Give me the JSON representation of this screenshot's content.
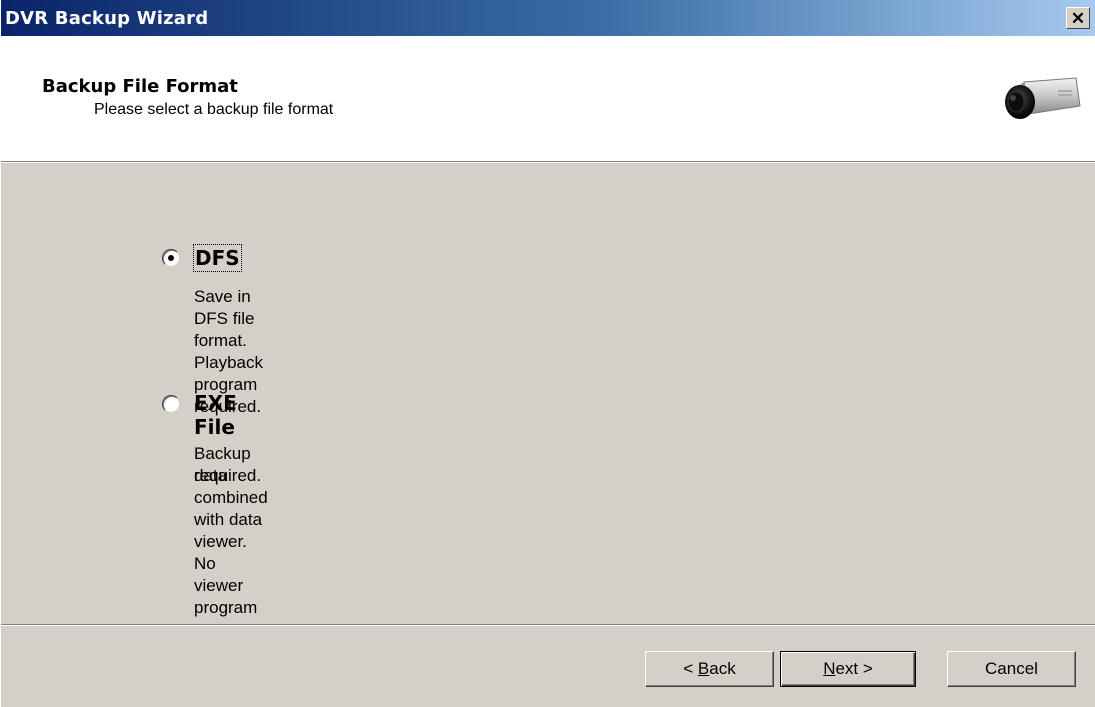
{
  "window": {
    "title": "DVR Backup Wizard",
    "close_glyph": "✕",
    "close_icon": "close-icon"
  },
  "header": {
    "title": "Backup File Format",
    "subtitle": "Please select a backup file format",
    "image_icon": "camera-icon"
  },
  "options": [
    {
      "label": "DFS",
      "description": "Save in DFS file format. Playback program required.",
      "selected": true
    },
    {
      "label": "EXE File",
      "description_line1": "Backup data combined with data viewer. No viewer program",
      "description_line2": "required.",
      "selected": false
    }
  ],
  "buttons": {
    "back_prefix": "< ",
    "back_mnemonic": "B",
    "back_rest": "ack",
    "next_mnemonic": "N",
    "next_rest": "ext >",
    "cancel": "Cancel"
  },
  "colors": {
    "titlebar_start": "#0a246a",
    "titlebar_end": "#a6caf0",
    "dialog_bg": "#d4d0c8",
    "header_bg": "#ffffff"
  }
}
